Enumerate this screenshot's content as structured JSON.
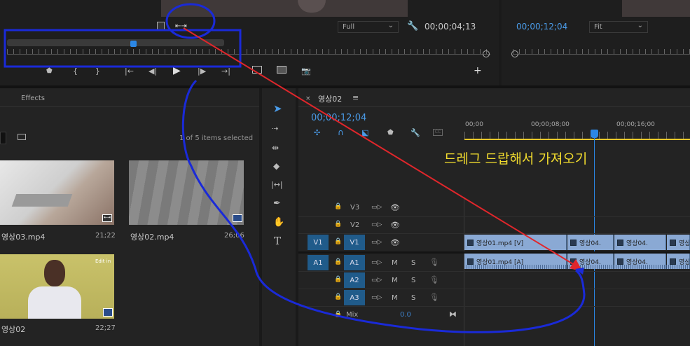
{
  "source_monitor": {
    "fit_select": "Full",
    "timecode": "00;00;04;13"
  },
  "program_monitor": {
    "timecode": "00;00;12;04",
    "fit_select": "Fit"
  },
  "project_panel": {
    "tab_effects": "Effects",
    "items_selected": "1 of 5 items selected",
    "items": [
      {
        "name": "영상03.mp4",
        "duration": "21;22"
      },
      {
        "name": "영상02.mp4",
        "duration": "26;06"
      },
      {
        "name": "영상02",
        "duration": "22;27",
        "badge": "Edit in"
      }
    ]
  },
  "timeline": {
    "tab_title": "영상02",
    "timecode": "00;00;12;04",
    "ruler": [
      "00;00",
      "00;00;08;00",
      "00;00;16;00"
    ],
    "annotation": "드레그 드랍해서 가져오기",
    "tracks_video": [
      {
        "label": "V3"
      },
      {
        "label": "V2"
      },
      {
        "label": "V1",
        "source": "V1"
      }
    ],
    "tracks_audio": [
      {
        "label": "A1",
        "source": "A1"
      },
      {
        "label": "A2"
      },
      {
        "label": "A3"
      }
    ],
    "mix_label": "Mix",
    "mix_value": "0.0",
    "track_m": "M",
    "track_s": "S",
    "clips_v1": [
      {
        "label": "영상01.mp4 [V]"
      },
      {
        "label": "영상04."
      },
      {
        "label": "영상04."
      },
      {
        "label": "영상0"
      }
    ],
    "clips_a1": [
      {
        "label": "영상01.mp4 [A]"
      },
      {
        "label": "영상04."
      },
      {
        "label": "영상04."
      },
      {
        "label": "영상0"
      }
    ]
  },
  "colors": {
    "accent": "#4a9be8",
    "annotation": "#f2dc2e",
    "clip": "#8aa9d4",
    "track_header": "#205b8a",
    "markup_blue": "#1a2ad8",
    "markup_red": "#e0262b"
  },
  "icons": {
    "tools": [
      "selection-icon",
      "track-select-icon",
      "ripple-edit-icon",
      "razor-icon",
      "slip-icon",
      "pen-icon",
      "hand-icon",
      "type-icon"
    ]
  }
}
